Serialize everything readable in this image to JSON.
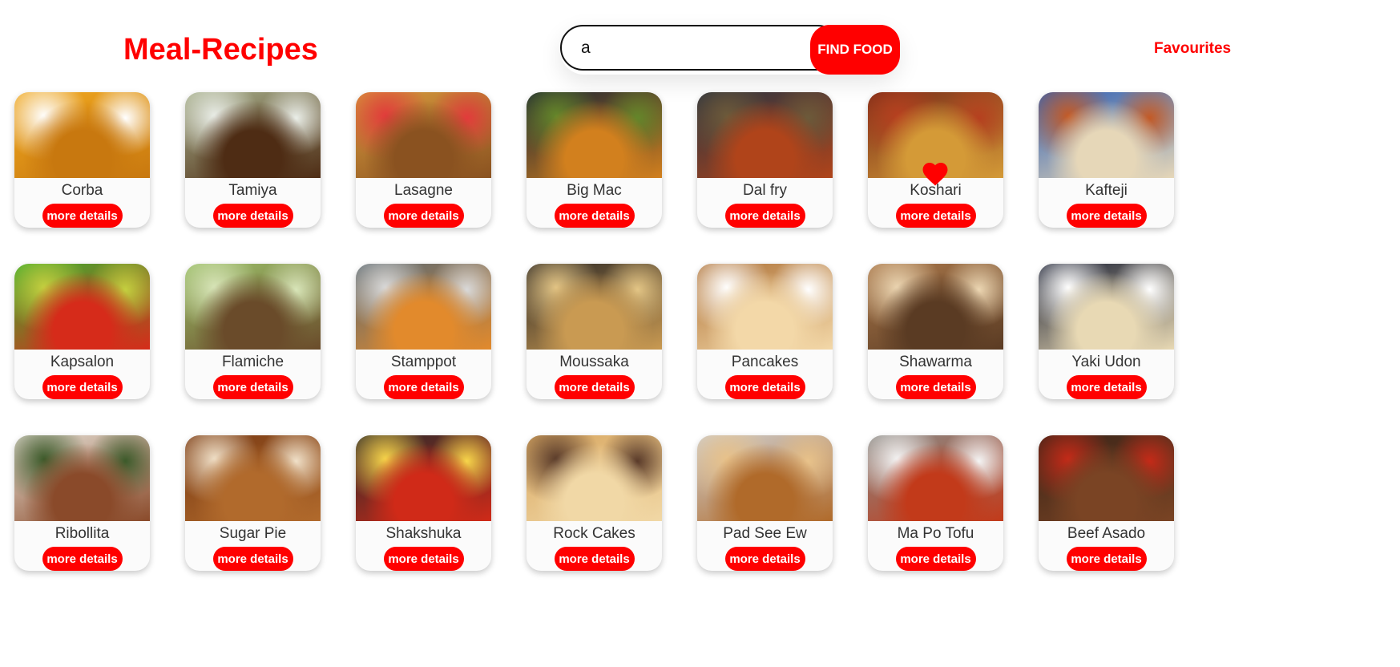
{
  "header": {
    "logo": "Meal-Recipes",
    "search_value": "a",
    "search_button": "FIND FOOD",
    "favourites_link": "Favourites"
  },
  "accent_color": "#ff0000",
  "more_details_label": "more details",
  "meals": [
    {
      "name": "Corba",
      "image": "soup-bowl-image",
      "colors": [
        "#f0a81f",
        "#c8780f",
        "#ffffff"
      ],
      "favourite": false
    },
    {
      "name": "Tamiya",
      "image": "falafel-plate-image",
      "colors": [
        "#a7b08c",
        "#4e2c14",
        "#eaeee8"
      ],
      "favourite": false
    },
    {
      "name": "Lasagne",
      "image": "lasagne-dish-image",
      "colors": [
        "#d89a3d",
        "#8a5220",
        "#e23b3b"
      ],
      "favourite": false
    },
    {
      "name": "Big Mac",
      "image": "burger-image",
      "colors": [
        "#1b2533",
        "#d2801e",
        "#64862a"
      ],
      "favourite": false
    },
    {
      "name": "Dal fry",
      "image": "dal-bowl-image",
      "colors": [
        "#2b3440",
        "#b0441a",
        "#6c5a3a"
      ],
      "favourite": false
    },
    {
      "name": "Koshari",
      "image": "koshari-plate-image",
      "colors": [
        "#7a2c18",
        "#d49a37",
        "#b6401f"
      ],
      "favourite": true
    },
    {
      "name": "Kafteji",
      "image": "kafteji-plate-image",
      "colors": [
        "#2f5fb3",
        "#e6d7b8",
        "#c35a26"
      ],
      "favourite": false
    },
    {
      "name": "Kapsalon",
      "image": "kapsalon-salad-image",
      "colors": [
        "#3fae2e",
        "#d62b1a",
        "#c4cf3f"
      ],
      "favourite": false
    },
    {
      "name": "Flamiche",
      "image": "flamiche-tart-image",
      "colors": [
        "#9cc16a",
        "#6a4b2a",
        "#d8e5b8"
      ],
      "favourite": false
    },
    {
      "name": "Stamppot",
      "image": "stamppot-plate-image",
      "colors": [
        "#5d6a72",
        "#e28a2c",
        "#d9d9d9"
      ],
      "favourite": false
    },
    {
      "name": "Moussaka",
      "image": "moussaka-pan-image",
      "colors": [
        "#2f2a26",
        "#c99a52",
        "#e3c585"
      ],
      "favourite": false
    },
    {
      "name": "Pancakes",
      "image": "pancakes-stack-image",
      "colors": [
        "#b0743a",
        "#f3d8a8",
        "#ffffff"
      ],
      "favourite": false
    },
    {
      "name": "Shawarma",
      "image": "shawarma-wrap-image",
      "colors": [
        "#a9774a",
        "#5a3b23",
        "#ecd6b2"
      ],
      "favourite": false
    },
    {
      "name": "Yaki Udon",
      "image": "yaki-udon-bowl-image",
      "colors": [
        "#1b2033",
        "#e8d9b4",
        "#ffffff"
      ],
      "favourite": false
    },
    {
      "name": "Ribollita",
      "image": "ribollita-bowl-image",
      "colors": [
        "#e5dfd4",
        "#8a4a2a",
        "#3c5a2a"
      ],
      "favourite": false
    },
    {
      "name": "Sugar Pie",
      "image": "sugar-pie-image",
      "colors": [
        "#7a3b14",
        "#b16a2c",
        "#f0e0c8"
      ],
      "favourite": false
    },
    {
      "name": "Shakshuka",
      "image": "shakshuka-pan-image",
      "colors": [
        "#2a2a2a",
        "#d02a18",
        "#f7d54a"
      ],
      "favourite": false
    },
    {
      "name": "Rock Cakes",
      "image": "rock-cakes-image",
      "colors": [
        "#d9a862",
        "#f1d8a6",
        "#5a3b2a"
      ],
      "favourite": false
    },
    {
      "name": "Pad See Ew",
      "image": "pad-see-ew-noodles-image",
      "colors": [
        "#cfcfcf",
        "#b06a2a",
        "#e8c28a"
      ],
      "favourite": false
    },
    {
      "name": "Ma Po Tofu",
      "image": "ma-po-tofu-bowl-image",
      "colors": [
        "#8a8a85",
        "#c23a1a",
        "#f4f4f4"
      ],
      "favourite": false
    },
    {
      "name": "Beef Asado",
      "image": "beef-asado-image",
      "colors": [
        "#3a2418",
        "#7a4424",
        "#c42a18"
      ],
      "favourite": false
    }
  ]
}
